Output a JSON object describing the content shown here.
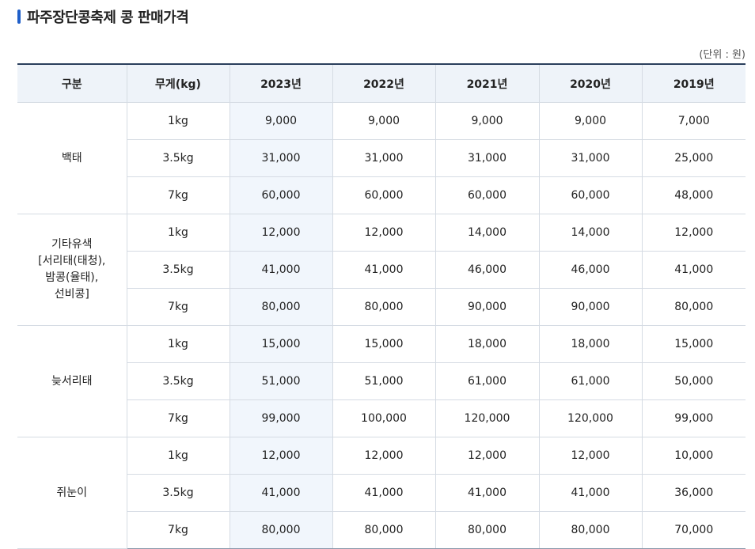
{
  "title": "파주장단콩축제 콩 판매가격",
  "unit": "(단위 : 원)",
  "headers": [
    "구분",
    "무게(kg)",
    "2023년",
    "2022년",
    "2021년",
    "2020년",
    "2019년"
  ],
  "groups": [
    {
      "name": "백태",
      "rows": [
        {
          "weight": "1kg",
          "prices": [
            "9,000",
            "9,000",
            "9,000",
            "9,000",
            "7,000"
          ]
        },
        {
          "weight": "3.5kg",
          "prices": [
            "31,000",
            "31,000",
            "31,000",
            "31,000",
            "25,000"
          ]
        },
        {
          "weight": "7kg",
          "prices": [
            "60,000",
            "60,000",
            "60,000",
            "60,000",
            "48,000"
          ]
        }
      ]
    },
    {
      "name": "기타유색\n[서리태(태청),\n밤콩(율태),\n선비콩]",
      "rows": [
        {
          "weight": "1kg",
          "prices": [
            "12,000",
            "12,000",
            "14,000",
            "14,000",
            "12,000"
          ]
        },
        {
          "weight": "3.5kg",
          "prices": [
            "41,000",
            "41,000",
            "46,000",
            "46,000",
            "41,000"
          ]
        },
        {
          "weight": "7kg",
          "prices": [
            "80,000",
            "80,000",
            "90,000",
            "90,000",
            "80,000"
          ]
        }
      ]
    },
    {
      "name": "늦서리태",
      "rows": [
        {
          "weight": "1kg",
          "prices": [
            "15,000",
            "15,000",
            "18,000",
            "18,000",
            "15,000"
          ]
        },
        {
          "weight": "3.5kg",
          "prices": [
            "51,000",
            "51,000",
            "61,000",
            "61,000",
            "50,000"
          ]
        },
        {
          "weight": "7kg",
          "prices": [
            "99,000",
            "100,000",
            "120,000",
            "120,000",
            "99,000"
          ]
        }
      ]
    },
    {
      "name": "쥐눈이",
      "rows": [
        {
          "weight": "1kg",
          "prices": [
            "12,000",
            "12,000",
            "12,000",
            "12,000",
            "10,000"
          ]
        },
        {
          "weight": "3.5kg",
          "prices": [
            "41,000",
            "41,000",
            "41,000",
            "41,000",
            "36,000"
          ]
        },
        {
          "weight": "7kg",
          "prices": [
            "80,000",
            "80,000",
            "80,000",
            "80,000",
            "70,000"
          ]
        }
      ]
    }
  ],
  "colors": {
    "accent": "#1f5fc9",
    "header_bg": "#eef3f9",
    "highlight_col_bg": "#f1f6fc",
    "header_top_border": "#2a3f5c"
  }
}
